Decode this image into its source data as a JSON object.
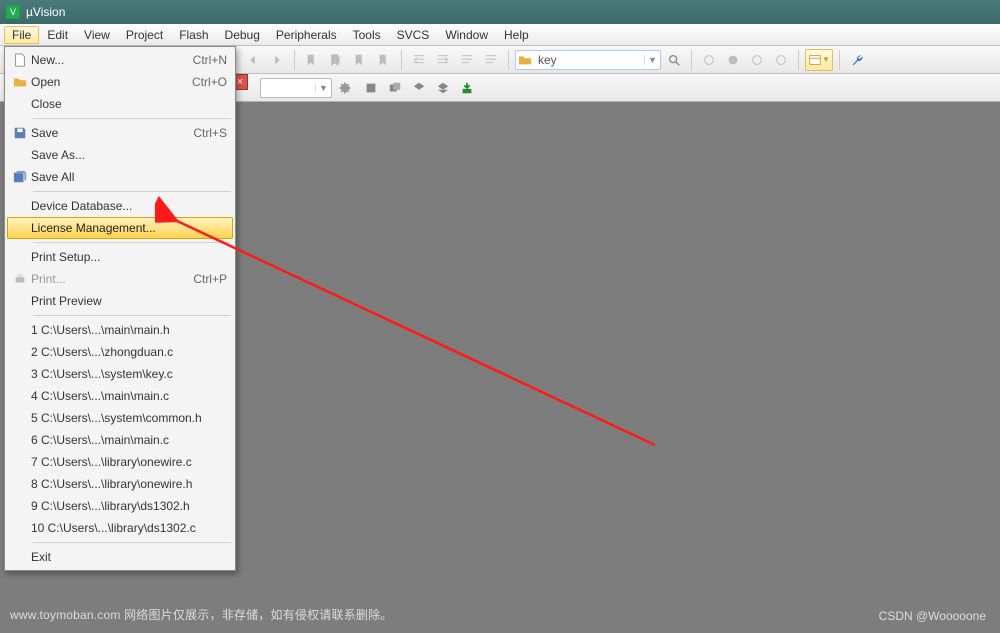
{
  "title_bar": {
    "title": "µVision"
  },
  "menu_bar": {
    "items": [
      "File",
      "Edit",
      "View",
      "Project",
      "Flash",
      "Debug",
      "Peripherals",
      "Tools",
      "SVCS",
      "Window",
      "Help"
    ],
    "open_index": 0
  },
  "toolbar_search": {
    "value": "key"
  },
  "file_menu": {
    "items": [
      {
        "label": "New...",
        "shortcut": "Ctrl+N",
        "icon": "file-new"
      },
      {
        "label": "Open",
        "shortcut": "Ctrl+O",
        "icon": "folder-open"
      },
      {
        "label": "Close",
        "shortcut": "",
        "icon": ""
      },
      {
        "sep": true
      },
      {
        "label": "Save",
        "shortcut": "Ctrl+S",
        "icon": "save"
      },
      {
        "label": "Save As...",
        "shortcut": "",
        "icon": ""
      },
      {
        "label": "Save All",
        "shortcut": "",
        "icon": "save-all"
      },
      {
        "sep": true
      },
      {
        "label": "Device Database...",
        "shortcut": "",
        "icon": ""
      },
      {
        "label": "License Management...",
        "shortcut": "",
        "icon": "",
        "highlight": true
      },
      {
        "sep": true
      },
      {
        "label": "Print Setup...",
        "shortcut": "",
        "icon": ""
      },
      {
        "label": "Print...",
        "shortcut": "Ctrl+P",
        "icon": "print",
        "disabled": true
      },
      {
        "label": "Print Preview",
        "shortcut": "",
        "icon": ""
      },
      {
        "sep": true
      },
      {
        "label": "1 C:\\Users\\...\\main\\main.h",
        "shortcut": "",
        "icon": ""
      },
      {
        "label": "2 C:\\Users\\...\\zhongduan.c",
        "shortcut": "",
        "icon": ""
      },
      {
        "label": "3 C:\\Users\\...\\system\\key.c",
        "shortcut": "",
        "icon": ""
      },
      {
        "label": "4 C:\\Users\\...\\main\\main.c",
        "shortcut": "",
        "icon": ""
      },
      {
        "label": "5 C:\\Users\\...\\system\\common.h",
        "shortcut": "",
        "icon": ""
      },
      {
        "label": "6 C:\\Users\\...\\main\\main.c",
        "shortcut": "",
        "icon": ""
      },
      {
        "label": "7 C:\\Users\\...\\library\\onewire.c",
        "shortcut": "",
        "icon": ""
      },
      {
        "label": "8 C:\\Users\\...\\library\\onewire.h",
        "shortcut": "",
        "icon": ""
      },
      {
        "label": "9 C:\\Users\\...\\library\\ds1302.h",
        "shortcut": "",
        "icon": ""
      },
      {
        "label": "10 C:\\Users\\...\\library\\ds1302.c",
        "shortcut": "",
        "icon": ""
      },
      {
        "sep": true
      },
      {
        "label": "Exit",
        "shortcut": "",
        "icon": ""
      }
    ]
  },
  "footer": {
    "left": "www.toymoban.com 网络图片仅展示，非存储，如有侵权请联系删除。",
    "right": "CSDN @Wooooone"
  }
}
